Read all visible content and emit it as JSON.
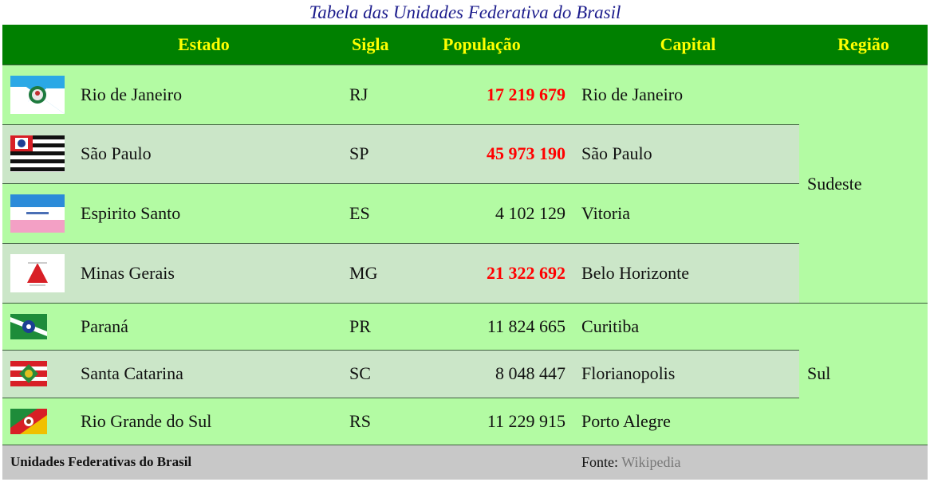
{
  "caption": "Tabela das Unidades Federativa do Brasil",
  "headers": {
    "estado": "Estado",
    "sigla": "Sigla",
    "populacao": "População",
    "capital": "Capital",
    "regiao": "Região"
  },
  "rows": [
    {
      "estado": "Rio de Janeiro",
      "sigla": "RJ",
      "populacao": "17 219 679",
      "capital": "Rio de Janeiro",
      "flag": "rj-flag-icon",
      "highlight": true
    },
    {
      "estado": "São Paulo",
      "sigla": "SP",
      "populacao": "45 973 190",
      "capital": "São Paulo",
      "flag": "sp-flag-icon",
      "highlight": true
    },
    {
      "estado": "Espirito Santo",
      "sigla": "ES",
      "populacao": "4 102 129",
      "capital": "Vitoria",
      "flag": "es-flag-icon",
      "highlight": false
    },
    {
      "estado": "Minas Gerais",
      "sigla": "MG",
      "populacao": "21 322 692",
      "capital": "Belo Horizonte",
      "flag": "mg-flag-icon",
      "highlight": true
    },
    {
      "estado": "Paraná",
      "sigla": "PR",
      "populacao": "11 824 665",
      "capital": "Curitiba",
      "flag": "pr-flag-icon",
      "highlight": false
    },
    {
      "estado": "Santa Catarina",
      "sigla": "SC",
      "populacao": "8 048 447",
      "capital": "Florianopolis",
      "flag": "sc-flag-icon",
      "highlight": false
    },
    {
      "estado": "Rio Grande do Sul",
      "sigla": "RS",
      "populacao": "11 229 915",
      "capital": "Porto Alegre",
      "flag": "rs-flag-icon",
      "highlight": false
    }
  ],
  "regions": {
    "sudeste": "Sudeste",
    "sul": "Sul"
  },
  "footer": {
    "title": "Unidades Federativas do Brasil",
    "source_label": "Fonte: ",
    "source_link": "Wikipedia"
  },
  "colors": {
    "header_bg": "#008000",
    "header_text": "#ffff00",
    "row_odd": "#b3fba3",
    "row_even": "#cbe6c8",
    "highlight_text": "#ff0000",
    "footer_bg": "#c8c8c8",
    "caption_text": "#1c1c8c"
  }
}
